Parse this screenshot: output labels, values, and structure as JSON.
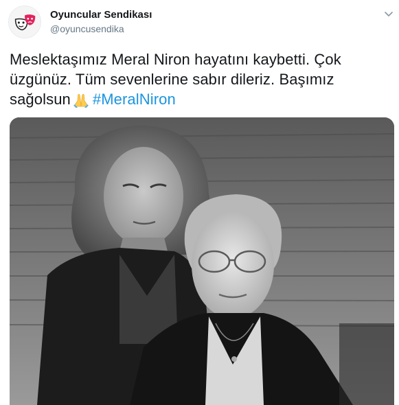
{
  "tweet": {
    "author": {
      "display_name": "Oyuncular Sendikası",
      "handle": "@oyuncusendika"
    },
    "text": {
      "line1": "Meslektaşımız Meral Niron hayatını kaybetti. Çok",
      "line2": "üzgünüz. Tüm sevenlerine sabır dileriz. Başımız",
      "line3": "sağolsun",
      "emoji": "folded-hands",
      "hashtag": "#MeralNiron"
    },
    "media": {
      "type": "photo",
      "style": "black-and-white portrait of two women"
    }
  },
  "colors": {
    "text": "#14171a",
    "secondary": "#657786",
    "link": "#1b95e0",
    "avatar_accent": "#e0245e"
  },
  "icons": {
    "more": "chevron-down-icon",
    "avatar": "theatre-mask-logo"
  }
}
